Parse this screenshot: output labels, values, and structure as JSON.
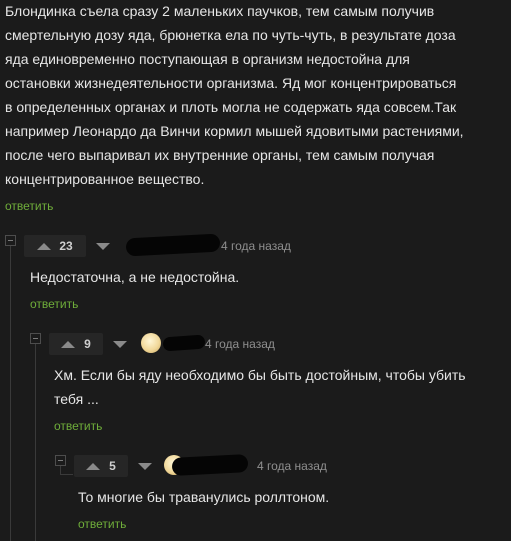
{
  "top_comment": {
    "text": "Блондинка съела сразу 2 маленьких паучков, тем самым получив\nсмертельную дозу яда, брюнетка ела по чуть-чуть, в результате доза\nяда единовременно поступающая в организм недостойна для\nостановки жизнедеятельности организма. Яд мог концентрироваться\nв определенных органах и плоть могла не содержать яда совсем.Так\nнапример Леонардо да Винчи кормил мышей ядовитыми растениями,\nпосле чего выпаривал их внутренние органы, тем самым получая\nконцентрированное вещество.",
    "reply_label": "ответить"
  },
  "comments": [
    {
      "rating": "23",
      "time": "4 года назад",
      "text": "Недостаточна, а не недостойна.",
      "reply_label": "ответить"
    },
    {
      "rating": "9",
      "time": "4 года назад",
      "text": "Хм. Если бы яду необходимо бы быть достойным, чтобы убить\nтебя ...",
      "reply_label": "ответить"
    },
    {
      "rating": "5",
      "time": "4 года назад",
      "text": "То многие бы траванулись роллтоном.",
      "reply_label": "ответить"
    }
  ],
  "colors": {
    "background": "#1b1b1b",
    "text": "#e6e6e6",
    "reply_link": "#6fae3a",
    "meta": "#8f8f8f"
  },
  "icons": [
    "collapse-icon",
    "upvote-icon",
    "downvote-icon",
    "avatar"
  ]
}
